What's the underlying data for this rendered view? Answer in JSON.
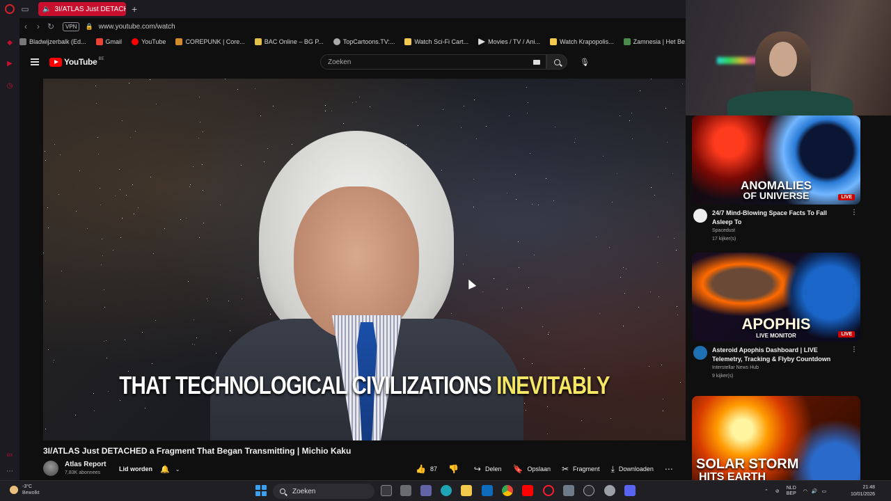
{
  "browser": {
    "tab_title": "3I/ATLAS Just DETACH",
    "url": "www.youtube.com/watch",
    "vpn_label": "VPN",
    "bookmarks": [
      {
        "label": "Bladwijzerbalk (Ed..."
      },
      {
        "label": "Gmail"
      },
      {
        "label": "YouTube"
      },
      {
        "label": "COREPUNK | Core..."
      },
      {
        "label": "BAC Online – BG P..."
      },
      {
        "label": "TopCartoons.TV:..."
      },
      {
        "label": "Watch Sci-Fi Cart..."
      },
      {
        "label": "Movies / TV / Ani..."
      },
      {
        "label": "Watch Krapopolis..."
      },
      {
        "label": "Zamnesia | Het Be..."
      }
    ]
  },
  "youtube": {
    "logo_text": "YouTube",
    "logo_country": "BE",
    "search_placeholder": "Zoeken"
  },
  "video": {
    "subtitle_main": "THAT TECHNOLOGICAL CIVILIZATIONS ",
    "subtitle_highlight": "INEVITABLY",
    "title": "3I/ATLAS Just DETACHED a Fragment That Began Transmitting | Michio Kaku",
    "channel_name": "Atlas Report",
    "channel_subs": "7,83K abonnees",
    "join_label": "Lid worden",
    "like_count": "87",
    "share_label": "Delen",
    "save_label": "Opslaan",
    "clip_label": "Fragment",
    "download_label": "Downloaden"
  },
  "recommendations": [
    {
      "thumb_text": "ANOMALIES",
      "thumb_text2": "OF UNIVERSE",
      "live": "LIVE",
      "title": "24/7 Mind-Blowing Space Facts To Fall Asleep To",
      "channel": "Spacedust",
      "views": "17 kijker(s)"
    },
    {
      "thumb_text": "APOPHIS",
      "thumb_text2": "LIVE MONITOR",
      "live": "LIVE",
      "title": "Asteroid Apophis Dashboard | LIVE Telemetry, Tracking & Flyby Countdown",
      "channel": "Interstellar News Hub",
      "views": "9 kijker(s)"
    },
    {
      "thumb_text": "SOLAR STORM",
      "thumb_text2": "HITS EARTH"
    }
  ],
  "taskbar": {
    "temperature": "-3°C",
    "weather": "Bewolkt",
    "search_label": "Zoeken",
    "lang_line1": "NLD",
    "lang_line2": "BEP",
    "time": "21:48",
    "date": "10/01/2026"
  },
  "colors": {
    "accent": "#c8102e",
    "youtube_red": "#ff0000",
    "subtitle_highlight": "#f5e663"
  }
}
